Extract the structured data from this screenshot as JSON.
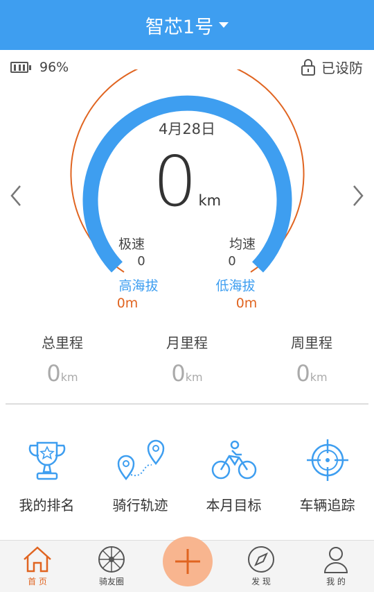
{
  "header": {
    "title": "智芯1号"
  },
  "status": {
    "battery_percent": "96%",
    "lock_status": "已设防"
  },
  "gauge": {
    "date": "4月28日",
    "distance_value": "0",
    "distance_unit": "km",
    "max_speed_label": "极速",
    "max_speed_value": "0",
    "avg_speed_label": "均速",
    "avg_speed_value": "0",
    "high_altitude_label": "高海拔",
    "high_altitude_value": "0m",
    "low_altitude_label": "低海拔",
    "low_altitude_value": "0m"
  },
  "totals": [
    {
      "label": "总里程",
      "value": "0",
      "unit": "km"
    },
    {
      "label": "月里程",
      "value": "0",
      "unit": "km"
    },
    {
      "label": "周里程",
      "value": "0",
      "unit": "km"
    }
  ],
  "features": [
    {
      "label": "我的排名",
      "icon": "trophy-icon"
    },
    {
      "label": "骑行轨迹",
      "icon": "route-icon"
    },
    {
      "label": "本月目标",
      "icon": "bicycle-icon"
    },
    {
      "label": "车辆追踪",
      "icon": "target-icon"
    }
  ],
  "tabbar": [
    {
      "label": "首 页",
      "icon": "home-icon",
      "active": true
    },
    {
      "label": "骑友圈",
      "icon": "wheel-icon",
      "active": false
    },
    {
      "label": "发 现",
      "icon": "compass-icon",
      "active": false
    },
    {
      "label": "我 的",
      "icon": "person-icon",
      "active": false
    }
  ],
  "colors": {
    "accent_blue": "#3e9ef0",
    "accent_orange": "#e06420"
  }
}
